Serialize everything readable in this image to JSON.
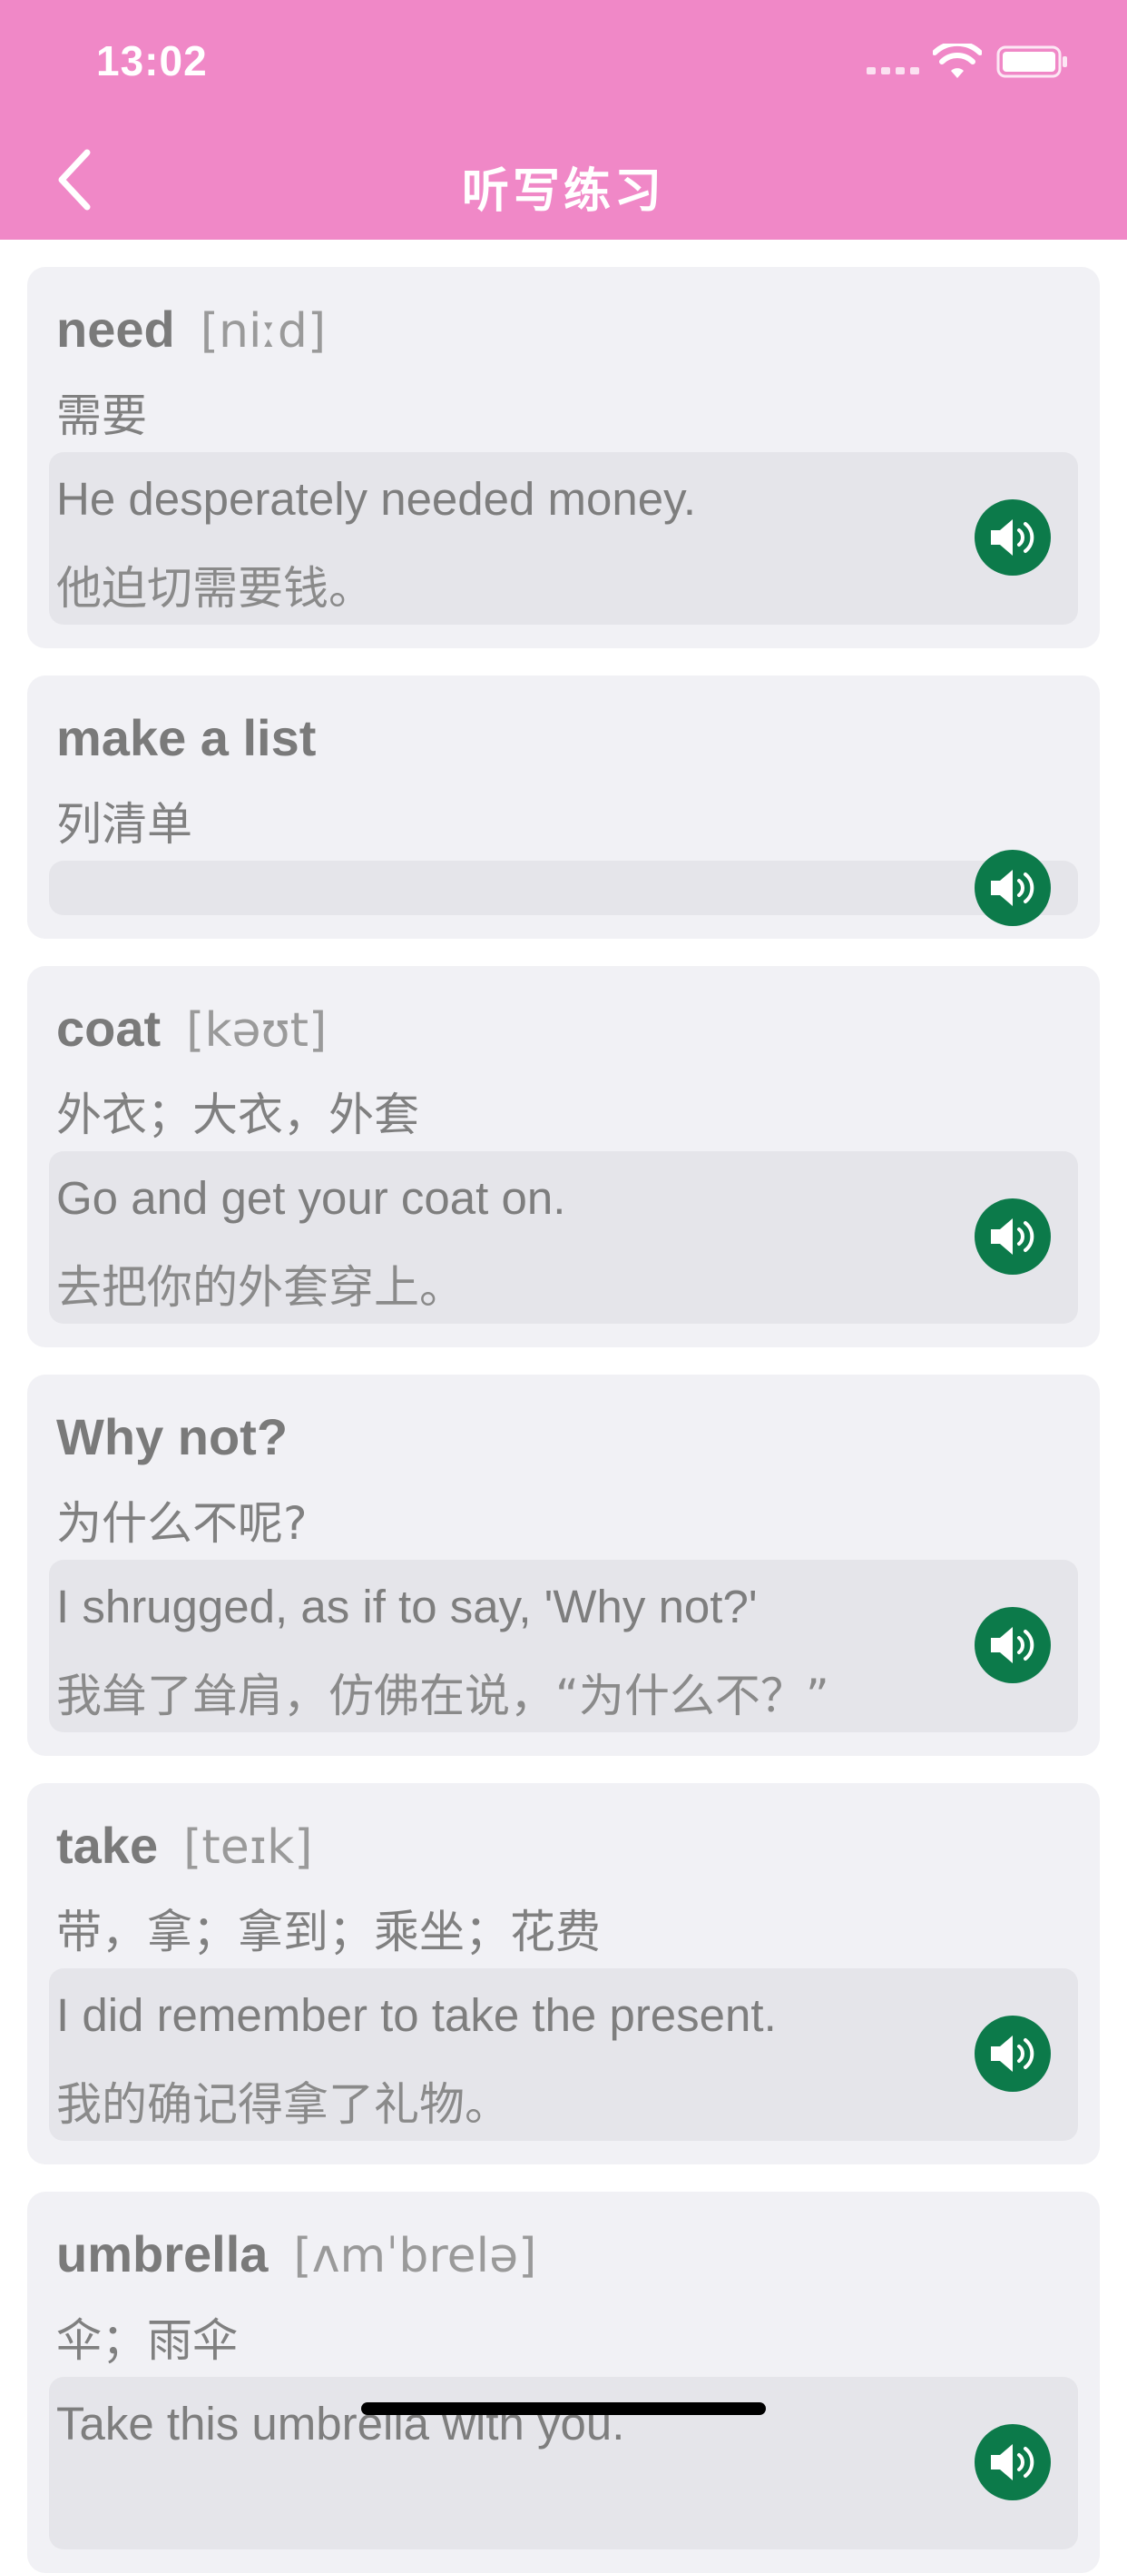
{
  "status_bar": {
    "time": "13:02"
  },
  "nav": {
    "title": "听写练习"
  },
  "colors": {
    "header": "#f088c7",
    "speaker": "#0c7a4a",
    "card": "#f1f1f5",
    "example_bg": "#e5e5ea"
  },
  "words": [
    {
      "word": "need",
      "phonetic": "[niːd]",
      "meaning": "需要",
      "example_en": "He desperately needed money.",
      "example_zh": "他迫切需要钱。"
    },
    {
      "word": "make a list",
      "phonetic": "",
      "meaning": "列清单",
      "example_en": "",
      "example_zh": ""
    },
    {
      "word": "coat",
      "phonetic": "[kəʊt]",
      "meaning": "外衣；大衣，外套",
      "example_en": "Go and get your coat on.",
      "example_zh": "去把你的外套穿上。"
    },
    {
      "word": "Why not?",
      "phonetic": "",
      "meaning": "为什么不呢?",
      "example_en": "I shrugged, as if to say, 'Why not?'",
      "example_zh": "我耸了耸肩，仿佛在说，“为什么不？”"
    },
    {
      "word": "take",
      "phonetic": "[teɪk]",
      "meaning": "带，拿；拿到；乘坐；花费",
      "example_en": "I did remember to take the present.",
      "example_zh": "我的确记得拿了礼物。"
    },
    {
      "word": "umbrella",
      "phonetic": "[ʌmˈbrelə]",
      "meaning": "伞；雨伞",
      "example_en": "Take this umbrella with you.",
      "example_zh": ""
    }
  ]
}
